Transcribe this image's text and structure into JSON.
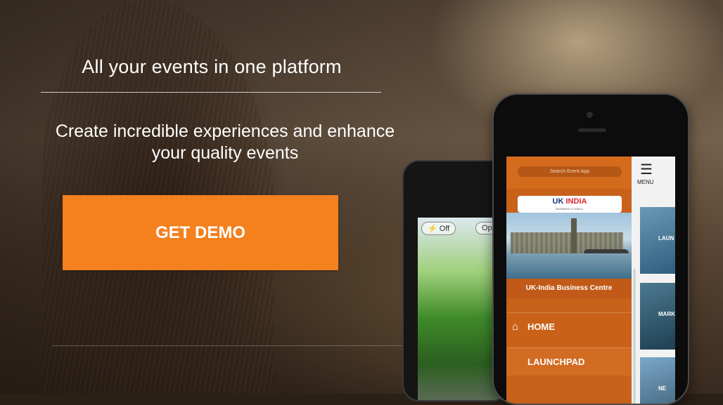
{
  "hero": {
    "headline": "All your events in one platform",
    "subheadline_line1": "Create incredible experiences and enhance",
    "subheadline_line2": "your quality events",
    "cta_label": "GET DEMO",
    "cta_color": "#f4801e"
  },
  "phone_back": {
    "toggle_label": "Off",
    "options_label": "Opt"
  },
  "phone_front": {
    "search_placeholder": "Search Event App",
    "logo_main": "UK",
    "logo_accent": "INDIA",
    "logo_sub": "BUSINESS COUNCIL",
    "section_title": "UK-India Business Centre",
    "menu_label": "MENU",
    "menu_items": [
      "HOME",
      "LAUNCHPAD"
    ],
    "side_thumbs": [
      "LAUN",
      "MARKE",
      "NE"
    ],
    "accent_color": "#c8611a"
  }
}
